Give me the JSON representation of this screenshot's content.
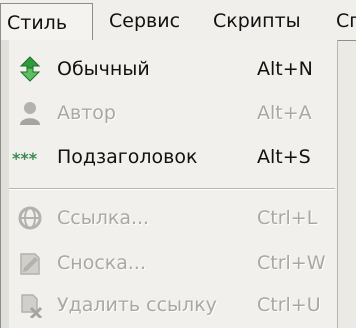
{
  "menubar": {
    "items": [
      {
        "label": "Стиль"
      },
      {
        "label": "Сервис"
      },
      {
        "label": "Скрипты"
      },
      {
        "label": "Сп"
      }
    ]
  },
  "dropdown": {
    "items": [
      {
        "label": "Обычный",
        "shortcut": "Alt+N",
        "icon": "normal-style-icon",
        "enabled": true
      },
      {
        "label": "Автор",
        "shortcut": "Alt+A",
        "icon": "author-icon",
        "enabled": false
      },
      {
        "label": "Подзаголовок",
        "shortcut": "Alt+S",
        "icon": "subtitle-icon",
        "enabled": true
      },
      {
        "label": "Ссылка...",
        "shortcut": "Ctrl+L",
        "icon": "link-icon",
        "enabled": false
      },
      {
        "label": "Сноска...",
        "shortcut": "Ctrl+W",
        "icon": "footnote-icon",
        "enabled": false
      },
      {
        "label": "Удалить ссылку",
        "shortcut": "Ctrl+U",
        "icon": "delete-link-icon",
        "enabled": false
      }
    ]
  },
  "colors": {
    "menu_background": "#f1f0ec",
    "disabled_text": "#a9a8a3",
    "normal_icon_green": "#2e9b3c"
  }
}
